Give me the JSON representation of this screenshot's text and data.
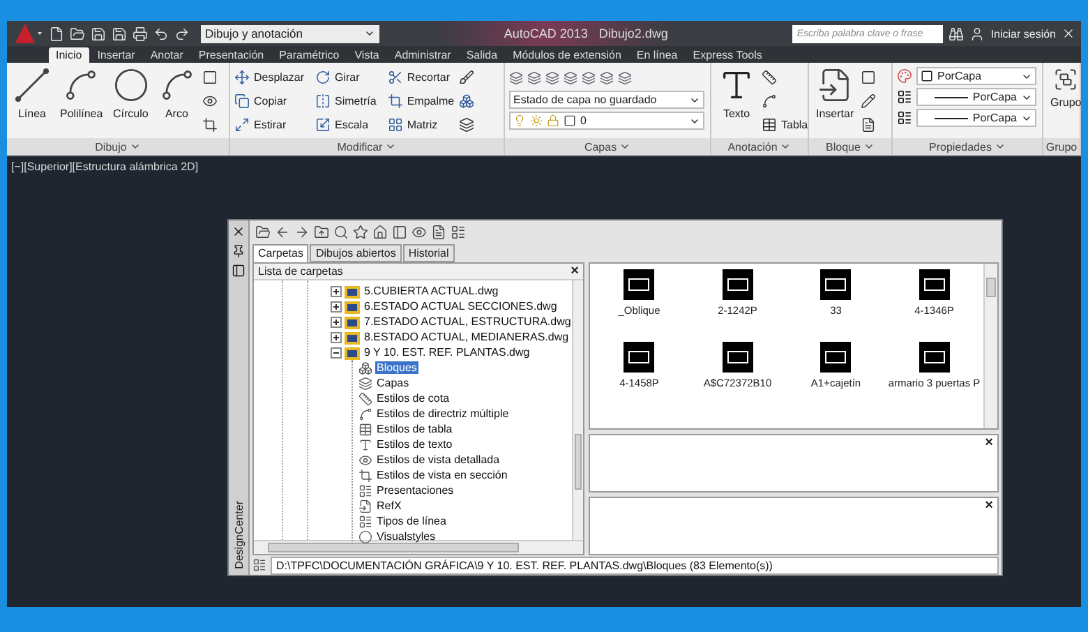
{
  "title_bar": {
    "workspace": "Dibujo y anotación",
    "app_title": "AutoCAD 2013",
    "document": "Dibujo2.dwg",
    "search": {
      "placeholder": "Escriba palabra clave o frase"
    },
    "sign_in": "Iniciar sesión"
  },
  "tabs": [
    {
      "label": "Inicio",
      "selected": true
    },
    {
      "label": "Insertar",
      "selected": false
    },
    {
      "label": "Anotar",
      "selected": false
    },
    {
      "label": "Presentación",
      "selected": false
    },
    {
      "label": "Paramétrico",
      "selected": false
    },
    {
      "label": "Vista",
      "selected": false
    },
    {
      "label": "Administrar",
      "selected": false
    },
    {
      "label": "Salida",
      "selected": false
    },
    {
      "label": "Módulos de extensión",
      "selected": false
    },
    {
      "label": "En línea",
      "selected": false
    },
    {
      "label": "Express Tools",
      "selected": false
    }
  ],
  "ribbon": {
    "panels": [
      {
        "kind": "draw",
        "title": "Dibujo",
        "large_tools": [
          "Línea",
          "Polilínea",
          "Círculo",
          "Arco"
        ]
      },
      {
        "kind": "modify",
        "title": "Modificar",
        "small_tools": [
          "Desplazar",
          "Girar",
          "Recortar",
          "Copiar",
          "Simetría",
          "Empalme",
          "Estirar",
          "Escala",
          "Matriz"
        ]
      },
      {
        "kind": "layers",
        "title": "Capas",
        "dropdowns": [
          "Estado de capa no guardado",
          "0"
        ]
      },
      {
        "kind": "annotation",
        "title": "Anotación",
        "large_tools": [
          "Texto"
        ],
        "small_tools": [
          "Tabla"
        ]
      },
      {
        "kind": "block",
        "title": "Bloque",
        "large_tools": [
          "Insertar"
        ]
      },
      {
        "kind": "properties",
        "title": "Propiedades",
        "dropdowns": [
          "PorCapa",
          "PorCapa",
          "PorCapa"
        ]
      },
      {
        "kind": "groups",
        "title": "Grupo",
        "large_tools": [
          "Grupo"
        ]
      }
    ]
  },
  "viewport_label": "[−][Superior][Estructura alámbrica 2D]",
  "design_center": {
    "title": "DesignCenter",
    "tabs": [
      {
        "label": "Carpetas",
        "selected": true
      },
      {
        "label": "Dibujos abiertos",
        "selected": false
      },
      {
        "label": "Historial",
        "selected": false
      }
    ],
    "folder_tree": {
      "header": "Lista de carpetas",
      "close": "×",
      "items": [
        {
          "label": "5.CUBIERTA ACTUAL.dwg",
          "expanded": false,
          "selected": false
        },
        {
          "label": "6.ESTADO ACTUAL SECCIONES.dwg",
          "expanded": false,
          "selected": false
        },
        {
          "label": "7.ESTADO ACTUAL, ESTRUCTURA.dwg",
          "expanded": false,
          "selected": false
        },
        {
          "label": "8.ESTADO ACTUAL, MEDIANERAS.dwg",
          "expanded": false,
          "selected": false
        },
        {
          "label": "9 Y 10. EST. REF. PLANTAS.dwg",
          "expanded": true,
          "selected": false,
          "children": [
            {
              "label": "Bloques",
              "selected": true
            },
            {
              "label": "Capas",
              "selected": false
            },
            {
              "label": "Estilos de cota",
              "selected": false
            },
            {
              "label": "Estilos de directriz múltiple",
              "selected": false
            },
            {
              "label": "Estilos de tabla",
              "selected": false
            },
            {
              "label": "Estilos de texto",
              "selected": false
            },
            {
              "label": "Estilos de vista detallada",
              "selected": false
            },
            {
              "label": "Estilos de vista en sección",
              "selected": false
            },
            {
              "label": "Presentaciones",
              "selected": false
            },
            {
              "label": "RefX",
              "selected": false
            },
            {
              "label": "Tipos de línea",
              "selected": false
            },
            {
              "label": "Visualstyles",
              "selected": false
            }
          ]
        }
      ]
    },
    "blocks": [
      "_Oblique",
      "2-1242P",
      "33",
      "4-1346P",
      "4-1458P",
      "A$C72372B10",
      "A1+cajetín",
      "armario 3 puertas P"
    ],
    "preview_close": "×",
    "description_close": "×",
    "status": "D:\\TPFC\\DOCUMENTACIÓN GRÁFICA\\9 Y 10. EST. REF. PLANTAS.dwg\\Bloques (83 Elemento(s))"
  }
}
